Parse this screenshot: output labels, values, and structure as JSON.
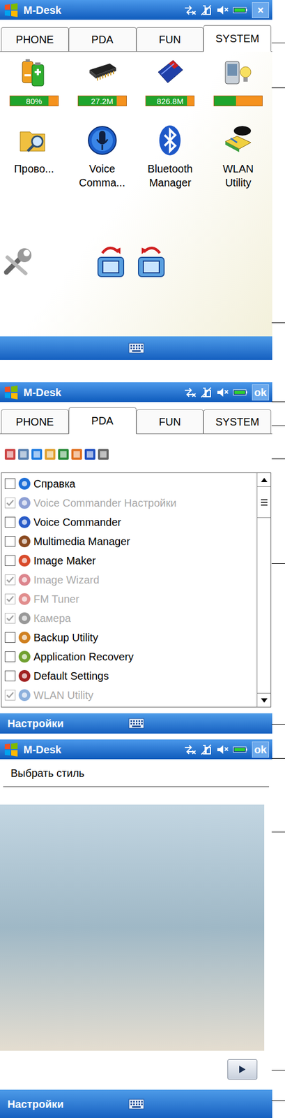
{
  "screens": [
    {
      "kind": "desk",
      "title": "M-Desk",
      "action": "×",
      "tabs": [
        {
          "label": "PHONE",
          "selected": false
        },
        {
          "label": "PDA",
          "selected": false
        },
        {
          "label": "FUN",
          "selected": false
        },
        {
          "label": "SYSTEM",
          "selected": true
        }
      ],
      "meters": [
        {
          "kind": "battery",
          "reading": "80%",
          "level": 0.8
        },
        {
          "kind": "memory",
          "reading": "27.2M",
          "level": 0.8
        },
        {
          "kind": "card",
          "reading": "826.8M",
          "level": 0.85
        },
        {
          "kind": "backlight",
          "level": 0.45
        }
      ],
      "apps": [
        {
          "kind": "explorer",
          "label": "Прово..."
        },
        {
          "kind": "voice",
          "label": "Voice Comma..."
        },
        {
          "kind": "bluetooth",
          "label": "Bluetooth Manager"
        },
        {
          "kind": "wlan",
          "label": "WLAN Utility"
        }
      ]
    },
    {
      "kind": "programs",
      "title": "M-Desk",
      "action": "ok",
      "tabs": [
        {
          "label": "PHONE",
          "selected": false
        },
        {
          "label": "PDA",
          "selected": true
        },
        {
          "label": "FUN",
          "selected": false
        },
        {
          "label": "SYSTEM",
          "selected": false
        }
      ],
      "programs": [
        {
          "label": "Справка",
          "checked": false,
          "disabled": false
        },
        {
          "label": "Voice Commander Настройки",
          "checked": true,
          "disabled": true
        },
        {
          "label": "Voice Commander",
          "checked": false,
          "disabled": false
        },
        {
          "label": "Multimedia Manager",
          "checked": false,
          "disabled": false
        },
        {
          "label": "Image Maker",
          "checked": false,
          "disabled": false
        },
        {
          "label": "Image Wizard",
          "checked": true,
          "disabled": true
        },
        {
          "label": "FM Tuner",
          "checked": true,
          "disabled": true
        },
        {
          "label": "Камера",
          "checked": true,
          "disabled": true
        },
        {
          "label": "Backup Utility",
          "checked": false,
          "disabled": false
        },
        {
          "label": "Application Recovery",
          "checked": false,
          "disabled": false
        },
        {
          "label": "Default Settings",
          "checked": false,
          "disabled": false
        },
        {
          "label": "WLAN Utility",
          "checked": true,
          "disabled": true
        }
      ],
      "softkey": "Настройки"
    },
    {
      "kind": "style",
      "title": "M-Desk",
      "action": "ok",
      "heading": "Выбрать стиль",
      "softkey": "Настройки"
    }
  ]
}
